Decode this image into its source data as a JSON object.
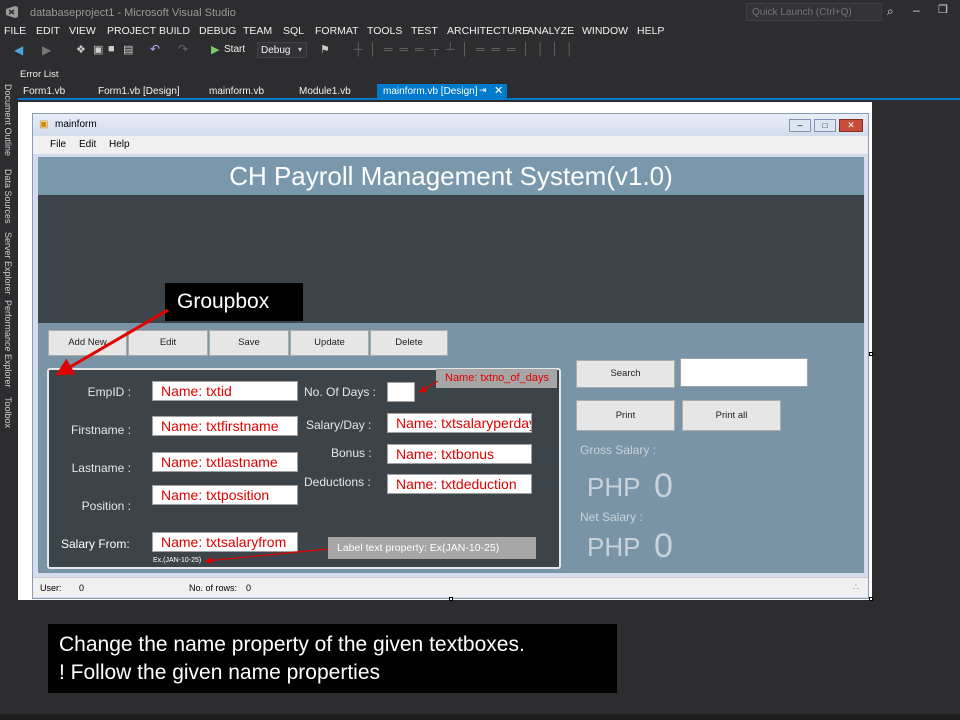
{
  "vs": {
    "title": "databaseproject1 - Microsoft Visual Studio",
    "quick_launch_placeholder": "Quick Launch (Ctrl+Q)",
    "menu": [
      "FILE",
      "EDIT",
      "VIEW",
      "PROJECT",
      "BUILD",
      "DEBUG",
      "TEAM",
      "SQL",
      "FORMAT",
      "TOOLS",
      "TEST",
      "ARCHITECTURE",
      "ANALYZE",
      "WINDOW",
      "HELP"
    ],
    "toolbar": {
      "start_label": "Start",
      "config": "Debug"
    },
    "error_list": "Error List",
    "tabs": [
      "Form1.vb",
      "Form1.vb [Design]",
      "mainform.vb",
      "Module1.vb",
      "mainform.vb [Design]"
    ],
    "side_panels": [
      "Document Outline",
      "Data Sources",
      "Server Explorer",
      "Performance Explorer",
      "Toolbox"
    ]
  },
  "form": {
    "title": "mainform",
    "menu": [
      "File",
      "Edit",
      "Help"
    ],
    "banner": "CH Payroll Management System(v1.0)",
    "buttons": {
      "add": "Add New",
      "edit": "Edit",
      "save": "Save",
      "update": "Update",
      "delete": "Delete",
      "search": "Search",
      "print": "Print",
      "print_all": "Print all"
    },
    "labels": {
      "empid": "EmpID :",
      "firstname": "Firstname :",
      "lastname": "Lastname :",
      "position": "Position :",
      "salary_from": "Salary From:",
      "days": "No. Of Days :",
      "salary_day": "Salary/Day :",
      "bonus": "Bonus :",
      "deductions": "Deductions :",
      "example": "Ex.(JAN-10-25)",
      "gross": "Gross Salary :",
      "net": "Net Salary :",
      "php": "PHP",
      "gross_value": "0",
      "net_value": "0"
    },
    "textboxes": {
      "txtid": "Name: txtid",
      "txtfirstname": "Name: txtfirstname",
      "txtlastname": "Name: txtlastname",
      "txtposition": "Name: txtposition",
      "txtsalaryfrom": "Name: txtsalaryfrom",
      "txtsalaryperday": "Name: txtsalaryperday",
      "txtbonus": "Name: txtbonus",
      "txtdeduction": "Name: txtdeduction"
    },
    "callouts": {
      "days": "Name: txtno_of_days",
      "label_text": "Label text property: Ex(JAN-10-25)"
    },
    "status": {
      "user_label": "User:",
      "user_value": "0",
      "rows_label": "No. of rows:",
      "rows_value": "0"
    }
  },
  "annotations": {
    "groupbox": "Groupbox",
    "instruction_line1": "Change the name property of the given textboxes.",
    "instruction_line2": "! Follow the given name properties"
  }
}
